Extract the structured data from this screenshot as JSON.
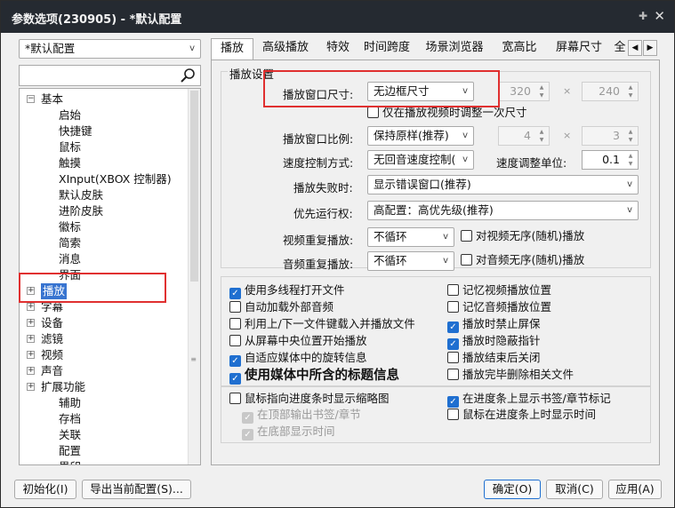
{
  "window": {
    "title": "参数选项(230905) - *默认配置",
    "pin_icon": "pin-icon",
    "close_icon": "close-icon"
  },
  "profile": {
    "selected": "*默认配置"
  },
  "search": {
    "value": "",
    "placeholder": ""
  },
  "tree": {
    "items": [
      {
        "label": "基本",
        "expander": "⊟"
      },
      {
        "label": "启始"
      },
      {
        "label": "快捷键"
      },
      {
        "label": "鼠标"
      },
      {
        "label": "触摸"
      },
      {
        "label": "XInput(XBOX 控制器)"
      },
      {
        "label": "默认皮肤"
      },
      {
        "label": "进阶皮肤"
      },
      {
        "label": "徽标"
      },
      {
        "label": "简索"
      },
      {
        "label": "消息"
      },
      {
        "label": "界面"
      },
      {
        "label": "播放",
        "expander": "⊞"
      },
      {
        "label": "字幕",
        "expander": "⊞"
      },
      {
        "label": "设备",
        "expander": "⊞"
      },
      {
        "label": "滤镜",
        "expander": "⊞"
      },
      {
        "label": "视频",
        "expander": "⊞"
      },
      {
        "label": "声音",
        "expander": "⊞"
      },
      {
        "label": "扩展功能",
        "expander": "⊞"
      },
      {
        "label": "辅助"
      },
      {
        "label": "存档"
      },
      {
        "label": "关联"
      },
      {
        "label": "配置"
      },
      {
        "label": "界印"
      }
    ]
  },
  "tabs": [
    "播放",
    "高级播放",
    "特效",
    "时间跨度",
    "场景浏览器",
    "宽高比",
    "屏幕尺寸",
    "全"
  ],
  "play_settings": {
    "group_title": "播放设置",
    "window_size_label": "播放窗口尺寸:",
    "window_size_value": "无边框尺寸",
    "width": "320",
    "height": "240",
    "times": "×",
    "resize_once": "仅在播放视频时调整一次尺寸",
    "ratio_label": "播放窗口比例:",
    "ratio_value": "保持原样(推荐)",
    "ratio_w": "4",
    "ratio_h": "3",
    "speed_label": "速度控制方式:",
    "speed_value": "无回音速度控制(",
    "speed_unit_label": "速度调整单位:",
    "speed_unit_value": "0.1",
    "fail_label": "播放失败时:",
    "fail_value": "显示错误窗口(推荐)",
    "priority_label": "优先运行权:",
    "priority_value": "高配置：高优先级(推荐)",
    "video_repeat_label": "视频重复播放:",
    "video_repeat_value": "不循环",
    "video_shuffle": "对视频无序(随机)播放",
    "audio_repeat_label": "音频重复播放:",
    "audio_repeat_value": "不循环",
    "audio_shuffle": "对音频无序(随机)播放"
  },
  "options_left": [
    {
      "label": "使用多线程打开文件",
      "checked": true
    },
    {
      "label": "自动加载外部音频",
      "checked": false
    },
    {
      "label": "利用上/下一文件键载入并播放文件",
      "checked": false
    },
    {
      "label": "从屏幕中央位置开始播放",
      "checked": false
    },
    {
      "label": "自适应媒体中的旋转信息",
      "checked": true
    },
    {
      "label": "使用媒体中所含的标题信息",
      "checked": true
    }
  ],
  "options_right": [
    {
      "label": "记忆视频播放位置",
      "checked": false
    },
    {
      "label": "记忆音频播放位置",
      "checked": false
    },
    {
      "label": "播放时禁止屏保",
      "checked": true
    },
    {
      "label": "播放时隐蔽指针",
      "checked": true
    },
    {
      "label": "播放结束后关闭",
      "checked": false
    },
    {
      "label": "播放完毕删除相关文件",
      "checked": false
    }
  ],
  "seek_options": {
    "thumbnail": "鼠标指向进度条时显示缩略图",
    "top_bookmark": "在顶部输出书签/章节",
    "bottom_time": "在底部显示时间",
    "show_marks": "在进度条上显示书签/章节标记",
    "show_time": "鼠标在进度条上时显示时间"
  },
  "buttons": {
    "init": "初始化(I)",
    "export": "导出当前配置(S)...",
    "ok": "确定(O)",
    "cancel": "取消(C)",
    "apply": "应用(A)"
  },
  "colors": {
    "accent": "#1f6fd0",
    "highlight": "#e03030",
    "titlebar": "#252a31"
  }
}
